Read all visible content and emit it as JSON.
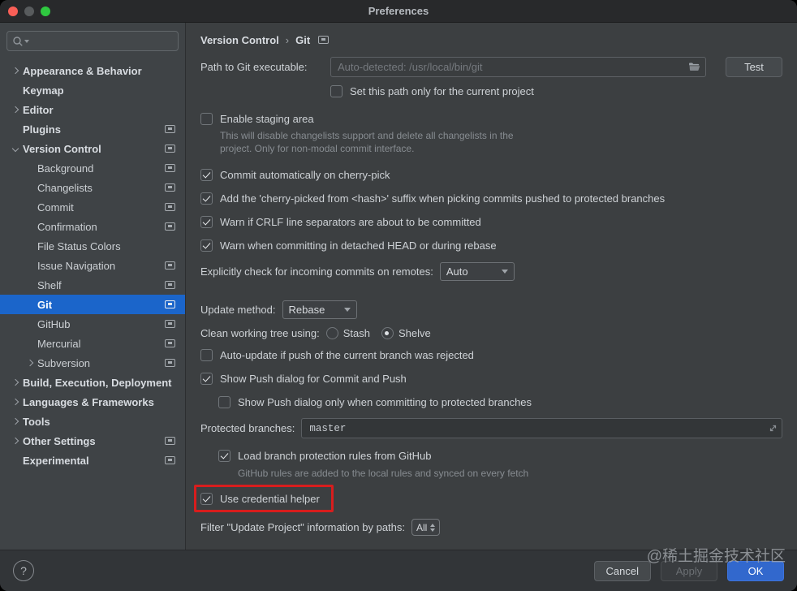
{
  "window": {
    "title": "Preferences"
  },
  "sidebar": {
    "items": [
      {
        "label": "Appearance & Behavior",
        "level": 0,
        "bold": true,
        "chevron": "right",
        "icon": false,
        "selected": false
      },
      {
        "label": "Keymap",
        "level": 0,
        "bold": true,
        "chevron": null,
        "icon": false,
        "selected": false
      },
      {
        "label": "Editor",
        "level": 0,
        "bold": true,
        "chevron": "right",
        "icon": false,
        "selected": false
      },
      {
        "label": "Plugins",
        "level": 0,
        "bold": true,
        "chevron": null,
        "icon": true,
        "selected": false
      },
      {
        "label": "Version Control",
        "level": 0,
        "bold": true,
        "chevron": "down",
        "icon": true,
        "selected": false
      },
      {
        "label": "Background",
        "level": 1,
        "bold": false,
        "chevron": null,
        "icon": true,
        "selected": false
      },
      {
        "label": "Changelists",
        "level": 1,
        "bold": false,
        "chevron": null,
        "icon": true,
        "selected": false
      },
      {
        "label": "Commit",
        "level": 1,
        "bold": false,
        "chevron": null,
        "icon": true,
        "selected": false
      },
      {
        "label": "Confirmation",
        "level": 1,
        "bold": false,
        "chevron": null,
        "icon": true,
        "selected": false
      },
      {
        "label": "File Status Colors",
        "level": 1,
        "bold": false,
        "chevron": null,
        "icon": false,
        "selected": false
      },
      {
        "label": "Issue Navigation",
        "level": 1,
        "bold": false,
        "chevron": null,
        "icon": true,
        "selected": false
      },
      {
        "label": "Shelf",
        "level": 1,
        "bold": false,
        "chevron": null,
        "icon": true,
        "selected": false
      },
      {
        "label": "Git",
        "level": 1,
        "bold": false,
        "chevron": null,
        "icon": true,
        "selected": true
      },
      {
        "label": "GitHub",
        "level": 1,
        "bold": false,
        "chevron": null,
        "icon": true,
        "selected": false
      },
      {
        "label": "Mercurial",
        "level": 1,
        "bold": false,
        "chevron": null,
        "icon": true,
        "selected": false
      },
      {
        "label": "Subversion",
        "level": 1,
        "bold": false,
        "chevron": "right",
        "icon": true,
        "selected": false
      },
      {
        "label": "Build, Execution, Deployment",
        "level": 0,
        "bold": true,
        "chevron": "right",
        "icon": false,
        "selected": false
      },
      {
        "label": "Languages & Frameworks",
        "level": 0,
        "bold": true,
        "chevron": "right",
        "icon": false,
        "selected": false
      },
      {
        "label": "Tools",
        "level": 0,
        "bold": true,
        "chevron": "right",
        "icon": false,
        "selected": false
      },
      {
        "label": "Other Settings",
        "level": 0,
        "bold": true,
        "chevron": "right",
        "icon": true,
        "selected": false
      },
      {
        "label": "Experimental",
        "level": 0,
        "bold": true,
        "chevron": null,
        "icon": true,
        "selected": false
      }
    ]
  },
  "breadcrumb": {
    "section": "Version Control",
    "separator": "›",
    "page": "Git"
  },
  "path_row": {
    "label": "Path to Git executable:",
    "value": "",
    "placeholder": "Auto-detected: /usr/local/bin/git",
    "test": "Test"
  },
  "set_path": {
    "label": "Set this path only for the current project",
    "checked": false
  },
  "staging": {
    "label": "Enable staging area",
    "checked": false,
    "hint": "This will disable changelists support and delete all changelists in the project. Only for non-modal commit interface."
  },
  "cherry_pick": {
    "label": "Commit automatically on cherry-pick",
    "checked": true
  },
  "cherry_suffix": {
    "label": "Add the 'cherry-picked from <hash>' suffix when picking commits pushed to protected branches",
    "checked": true
  },
  "crlf": {
    "label": "Warn if CRLF line separators are about to be committed",
    "checked": true
  },
  "detached": {
    "label": "Warn when committing in detached HEAD or during rebase",
    "checked": true
  },
  "incoming": {
    "label": "Explicitly check for incoming commits on remotes:",
    "value": "Auto"
  },
  "update_method": {
    "label": "Update method:",
    "value": "Rebase"
  },
  "clean_tree": {
    "label": "Clean working tree using:",
    "stash": "Stash",
    "shelve": "Shelve",
    "stash_selected": false,
    "shelve_selected": true
  },
  "auto_update": {
    "label": "Auto-update if push of the current branch was rejected",
    "checked": false
  },
  "push_dialog": {
    "label": "Show Push dialog for Commit and Push",
    "checked": true
  },
  "push_dialog_protected": {
    "label": "Show Push dialog only when committing to protected branches",
    "checked": false
  },
  "protected_branches": {
    "label": "Protected branches:",
    "value": "master"
  },
  "branch_rules": {
    "label": "Load branch protection rules from GitHub",
    "checked": true,
    "hint": "GitHub rules are added to the local rules and synced on every fetch"
  },
  "credential_helper": {
    "label": "Use credential helper",
    "checked": true
  },
  "filter_paths": {
    "label": "Filter \"Update Project\" information by paths:",
    "value": "All"
  },
  "footer": {
    "help": "?",
    "cancel": "Cancel",
    "apply": "Apply",
    "ok": "OK",
    "watermark": "@稀土掘金技术社区"
  },
  "colors": {
    "selection": "#1b65ca",
    "ok_button": "#3268cd",
    "annotation": "#d81d1d"
  }
}
